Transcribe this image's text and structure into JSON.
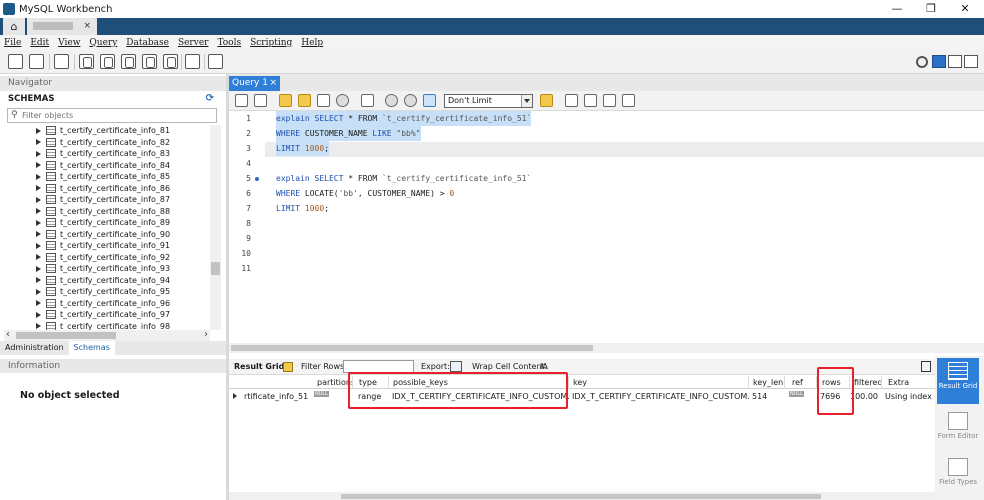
{
  "window": {
    "title": "MySQL Workbench",
    "minimize": "—",
    "maximize": "❐",
    "close": "✕"
  },
  "menu": [
    "File",
    "Edit",
    "View",
    "Query",
    "Database",
    "Server",
    "Tools",
    "Scripting",
    "Help"
  ],
  "navigator": {
    "header": "Navigator",
    "schemas_label": "SCHEMAS",
    "filter_placeholder": "Filter objects",
    "tables": [
      "t_certify_certificate_info_81",
      "t_certify_certificate_info_82",
      "t_certify_certificate_info_83",
      "t_certify_certificate_info_84",
      "t_certify_certificate_info_85",
      "t_certify_certificate_info_86",
      "t_certify_certificate_info_87",
      "t_certify_certificate_info_88",
      "t_certify_certificate_info_89",
      "t_certify_certificate_info_90",
      "t_certify_certificate_info_91",
      "t_certify_certificate_info_92",
      "t_certify_certificate_info_93",
      "t_certify_certificate_info_94",
      "t_certify_certificate_info_95",
      "t_certify_certificate_info_96",
      "t_certify_certificate_info_97",
      "t_certify_certificate_info_98"
    ],
    "tabs": {
      "administration": "Administration",
      "schemas": "Schemas"
    }
  },
  "information": {
    "header": "Information",
    "empty_text": "No object selected"
  },
  "query_tab": {
    "label": "Query 1",
    "close": "×"
  },
  "limit_select": {
    "value": "Don't Limit"
  },
  "editor": {
    "line_numbers": [
      "1",
      "2",
      "3",
      "4",
      "5",
      "6",
      "7",
      "8",
      "9",
      "10",
      "11"
    ],
    "lines": {
      "l1_kw": "explain SELECT",
      "l1_rest": " * FROM ",
      "l1_kw2": "",
      "l1_tbl": "`t_certify_certificate_info_51`",
      "l2_kw": "WHERE",
      "l2_rest": " CUSTOMER_NAME ",
      "l2_kw2": "LIKE",
      "l2_str": " \"bb%\"",
      "l3_kw": "LIMIT",
      "l3_num": " 1000",
      "l3_rest": ";",
      "l5_kw": "explain SELECT",
      "l5_rest": " * FROM ",
      "l5_tbl": "`t_certify_certificate_info_51`",
      "l6_kw": "WHERE",
      "l6_rest": " LOCATE(",
      "l6_str": "'bb'",
      "l6_rest2": ", CUSTOMER_NAME) > ",
      "l6_num": "0",
      "l7_kw": "LIMIT",
      "l7_num": " 1000",
      "l7_rest": ";"
    }
  },
  "result_toolbar": {
    "result_grid": "Result Grid",
    "filter_rows": "Filter Rows:",
    "export": "Export:",
    "wrap": "Wrap Cell Content:",
    "wrap_icon": "IA"
  },
  "result_grid": {
    "headers": [
      "partitions",
      "type",
      "possible_keys",
      "key",
      "key_len",
      "ref",
      "rows",
      "filtered",
      "Extra"
    ],
    "row": {
      "table": "rtificate_info_51",
      "partitions": "NULL",
      "type": "range",
      "possible_keys": "IDX_T_CERTIFY_CERTIFICATE_INFO_CUSTOM...",
      "key": "IDX_T_CERTIFY_CERTIFICATE_INFO_CUSTOM...",
      "key_len": "514",
      "ref": "NULL",
      "rows": "7696",
      "filtered": "100.00",
      "extra": "Using index condition"
    }
  },
  "side_panel": {
    "result_grid": "Result Grid",
    "form_editor": "Form Editor",
    "field_types": "Field Types"
  },
  "colors": {
    "accent": "#2f7ed8",
    "tab_strip": "#1f4e79",
    "highlight_box": "#e8202a",
    "selection": "#c7e0f7"
  }
}
